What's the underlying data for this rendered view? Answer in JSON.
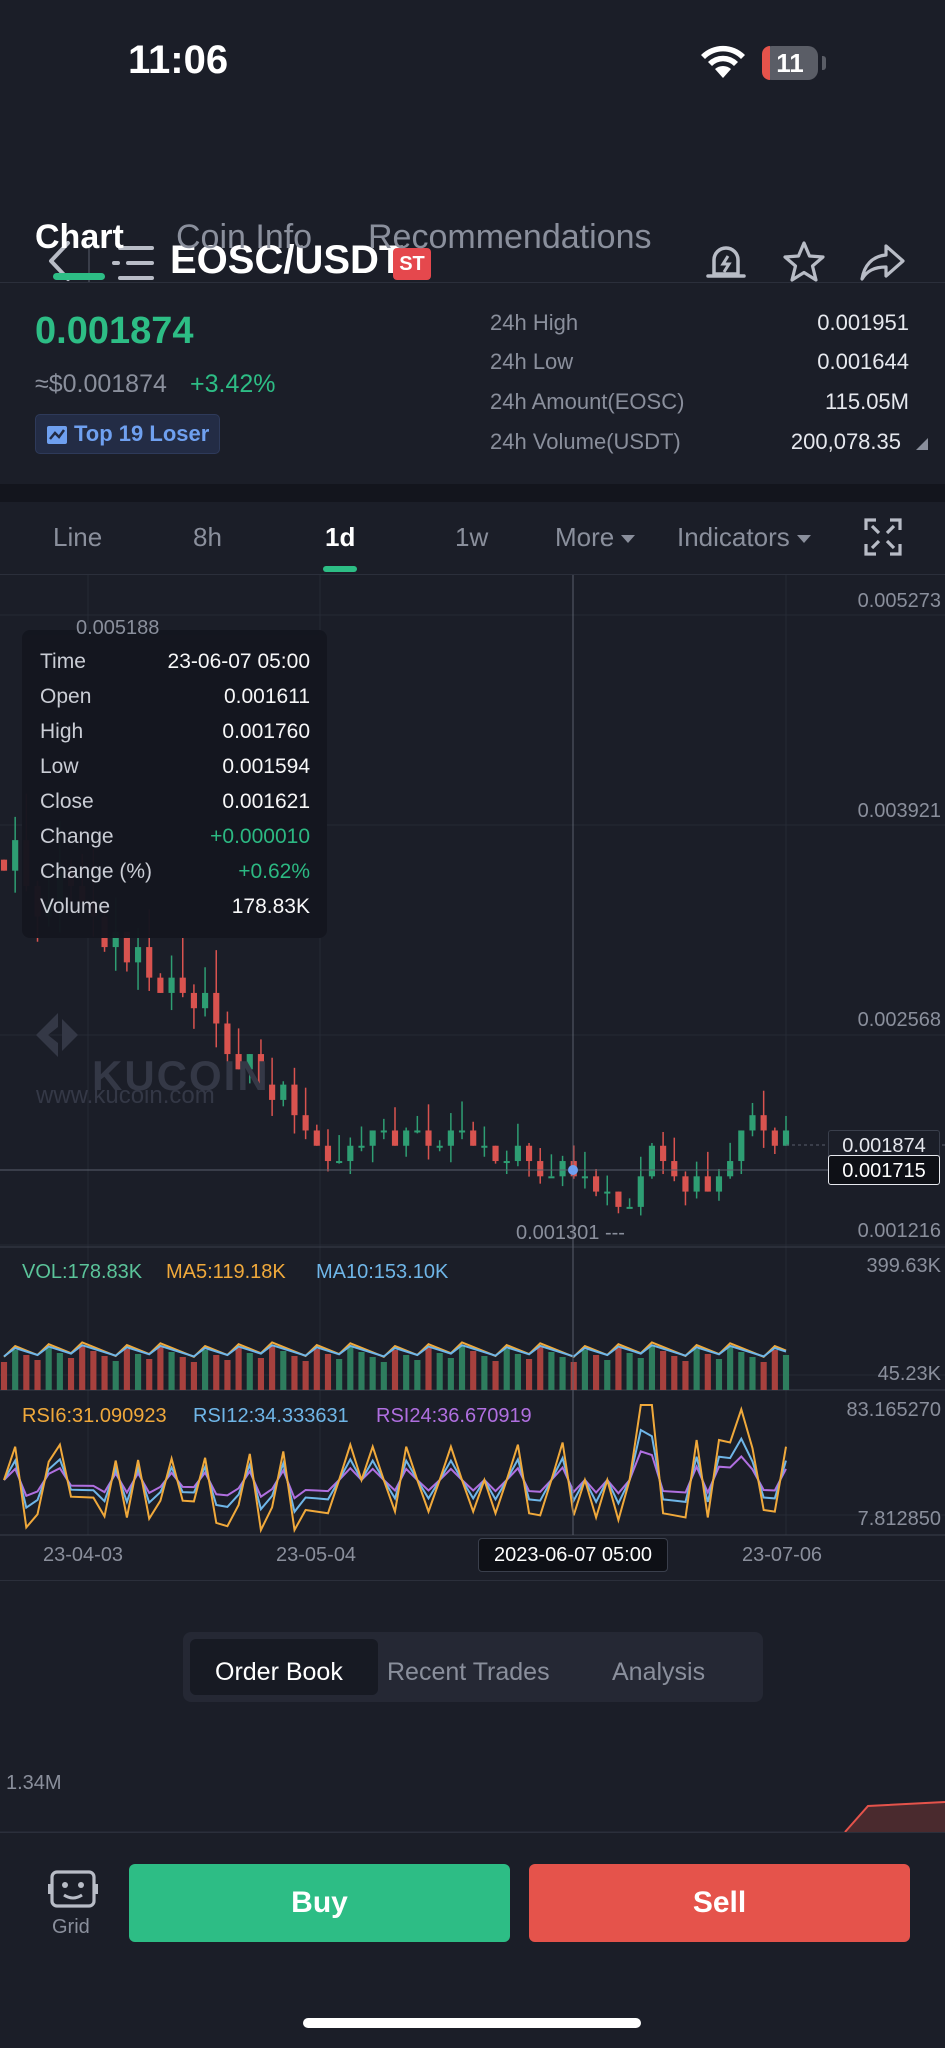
{
  "status_bar": {
    "time": "11:06",
    "battery": "11"
  },
  "header": {
    "pair": "EOSC/USDT",
    "badge": "ST"
  },
  "top_tabs": [
    {
      "label": "Chart"
    },
    {
      "label": "Coin Info"
    },
    {
      "label": "Recommendations"
    }
  ],
  "ticker": {
    "price": "0.001874",
    "fiat": "≈$0.001874",
    "change": "+3.42%",
    "tag": "Top 19 Loser",
    "stats": [
      {
        "label": "24h High",
        "value": "0.001951"
      },
      {
        "label": "24h Low",
        "value": "0.001644"
      },
      {
        "label": "24h Amount(EOSC)",
        "value": "115.05M"
      },
      {
        "label": "24h Volume(USDT)",
        "value": "200,078.35"
      }
    ]
  },
  "timeframes": [
    {
      "label": "Line"
    },
    {
      "label": "8h"
    },
    {
      "label": "1d"
    },
    {
      "label": "1w"
    },
    {
      "label": "More"
    },
    {
      "label": "Indicators"
    }
  ],
  "tooltip": {
    "rows": [
      {
        "k": "Time",
        "v": "23-06-07 05:00"
      },
      {
        "k": "Open",
        "v": "0.001611"
      },
      {
        "k": "High",
        "v": "0.001760"
      },
      {
        "k": "Low",
        "v": "0.001594"
      },
      {
        "k": "Close",
        "v": "0.001621"
      },
      {
        "k": "Change",
        "v": "+0.000010"
      },
      {
        "k": "Change (%)",
        "v": "+0.62%"
      },
      {
        "k": "Volume",
        "v": "178.83K"
      }
    ]
  },
  "chart": {
    "price_axis": [
      "0.005273",
      "0.003921",
      "0.002568",
      "0.001216"
    ],
    "max_label": "0.005188",
    "min_label": "0.001301 ---",
    "last_price": "0.001874",
    "cross_price": "0.001715",
    "watermark": "KUCOIN",
    "watermark_url": "www.kucoin.com",
    "vol_axis": [
      "399.63K",
      "45.23K"
    ],
    "rsi_axis": [
      "83.165270",
      "7.812850"
    ],
    "x_axis": [
      "23-04-03",
      "23-05-04",
      "23-07-06"
    ],
    "cross_date": "2023-06-07 05:00",
    "vol_labels": {
      "vol": "VOL:178.83K",
      "ma5": "MA5:119.18K",
      "ma10": "MA10:153.10K"
    },
    "rsi_labels": {
      "rsi6": "RSI6:31.090923",
      "rsi12": "RSI12:34.333631",
      "rsi24": "RSI24:36.670919"
    }
  },
  "chart_data": {
    "type": "candlestick",
    "title": "",
    "xlabel": "",
    "ylabel": "",
    "ylim": [
      0.001216,
      0.005273
    ],
    "closes": [
      0.0036,
      0.0038,
      0.0035,
      0.0033,
      0.0034,
      0.0036,
      0.0035,
      0.0034,
      0.0033,
      0.0031,
      0.0032,
      0.003,
      0.0031,
      0.0029,
      0.0028,
      0.0029,
      0.0028,
      0.0027,
      0.0028,
      0.0026,
      0.0024,
      0.0023,
      0.0024,
      0.0022,
      0.0021,
      0.0022,
      0.002,
      0.0019,
      0.0018,
      0.0017,
      0.0017,
      0.0018,
      0.0018,
      0.0019,
      0.0019,
      0.0018,
      0.0019,
      0.0019,
      0.0018,
      0.0018,
      0.0019,
      0.0019,
      0.0018,
      0.0018,
      0.0017,
      0.0017,
      0.0018,
      0.0017,
      0.0016,
      0.0016,
      0.0017,
      0.0016,
      0.0016,
      0.0015,
      0.0015,
      0.0014,
      0.0014,
      0.0016,
      0.0018,
      0.0017,
      0.0016,
      0.0015,
      0.0016,
      0.0015,
      0.0016,
      0.0017,
      0.0019,
      0.002,
      0.0019,
      0.0018,
      0.0019
    ]
  },
  "segmented": [
    {
      "label": "Order Book"
    },
    {
      "label": "Recent Trades"
    },
    {
      "label": "Analysis"
    }
  ],
  "order_book": {
    "depth_label": "1.34M"
  },
  "bottom": {
    "grid": "Grid",
    "buy": "Buy",
    "sell": "Sell"
  }
}
